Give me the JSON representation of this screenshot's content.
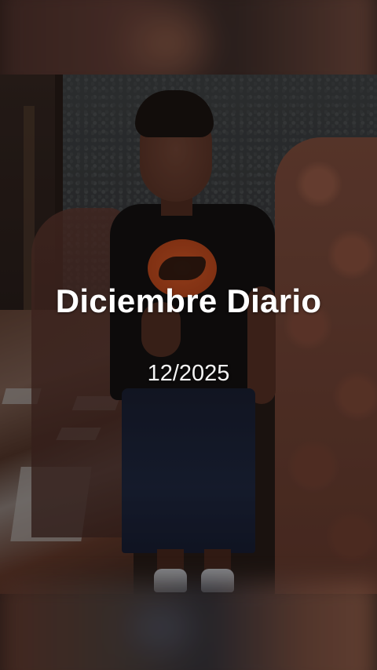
{
  "story": {
    "title": "Diciembre Diario",
    "date": "12/2025"
  }
}
